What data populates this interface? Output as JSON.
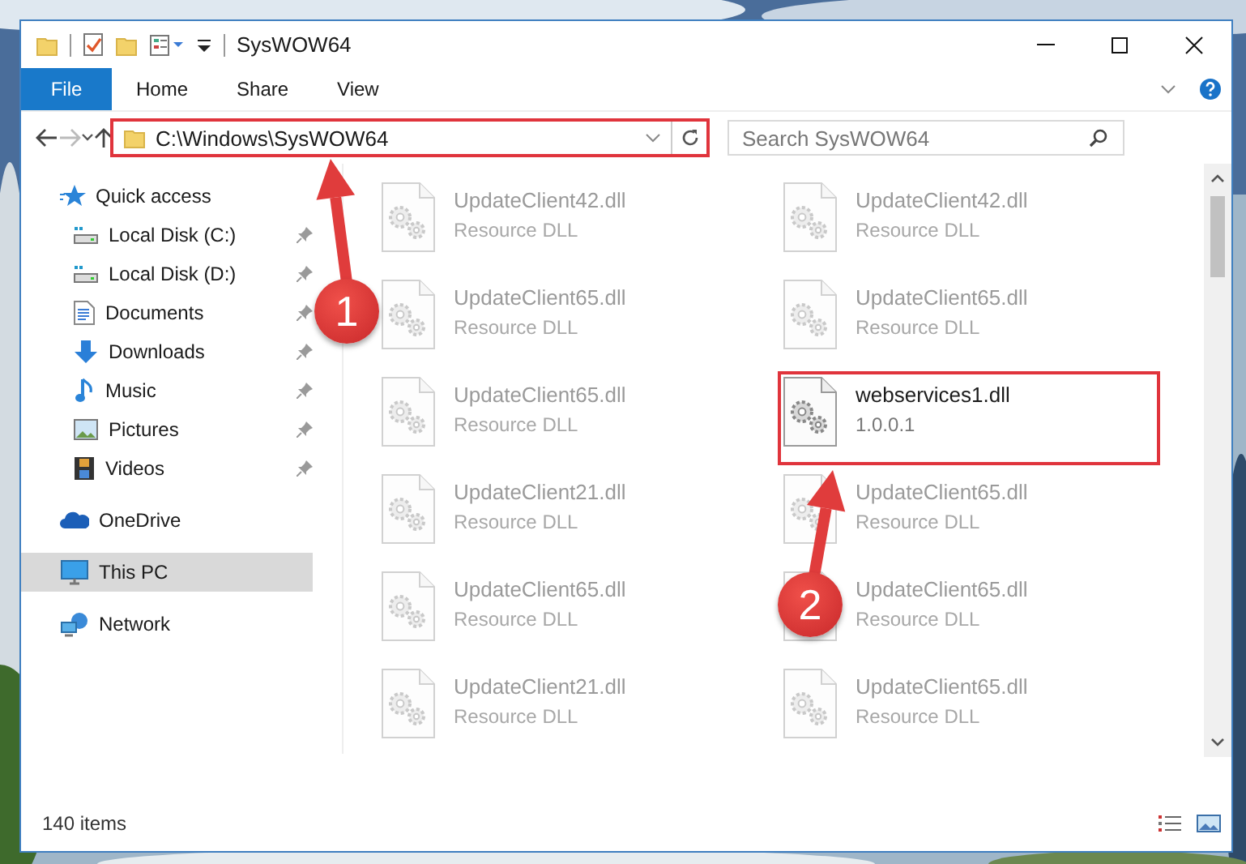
{
  "window": {
    "title": "SysWOW64"
  },
  "ribbon": {
    "tabs": [
      {
        "label": "File",
        "kind": "file"
      },
      {
        "label": "Home",
        "kind": "tab"
      },
      {
        "label": "Share",
        "kind": "tab"
      },
      {
        "label": "View",
        "kind": "tab"
      }
    ]
  },
  "address_bar": {
    "path": "C:\\Windows\\SysWOW64",
    "highlighted": true
  },
  "search": {
    "placeholder": "Search SysWOW64"
  },
  "navigation": [
    {
      "label": "Quick access",
      "kind": "star",
      "selected": false,
      "children": [
        {
          "label": "Local Disk (C:)",
          "kind": "drive",
          "selected": false,
          "pinned": true
        },
        {
          "label": "Local Disk (D:)",
          "kind": "drive",
          "selected": false,
          "pinned": true
        },
        {
          "label": "Documents",
          "kind": "documents",
          "selected": false,
          "pinned": true
        },
        {
          "label": "Downloads",
          "kind": "downloads",
          "selected": false,
          "pinned": true
        },
        {
          "label": "Music",
          "kind": "music",
          "selected": false,
          "pinned": true
        },
        {
          "label": "Pictures",
          "kind": "pictures",
          "selected": false,
          "pinned": true
        },
        {
          "label": "Videos",
          "kind": "videos",
          "selected": false,
          "pinned": true
        }
      ]
    },
    {
      "label": "OneDrive",
      "kind": "cloud",
      "selected": false
    },
    {
      "label": "This PC",
      "kind": "computer",
      "selected": true
    },
    {
      "label": "Network",
      "kind": "network",
      "selected": false
    }
  ],
  "files": [
    {
      "name": "UpdateClient42.dll",
      "detail": "Resource DLL",
      "blurred": true,
      "highlighted": false
    },
    {
      "name": "UpdateClient42.dll",
      "detail": "Resource DLL",
      "blurred": true,
      "highlighted": false
    },
    {
      "name": "UpdateClient65.dll",
      "detail": "Resource DLL",
      "blurred": true,
      "highlighted": false
    },
    {
      "name": "UpdateClient65.dll",
      "detail": "Resource DLL",
      "blurred": true,
      "highlighted": false
    },
    {
      "name": "UpdateClient65.dll",
      "detail": "Resource DLL",
      "blurred": true,
      "highlighted": false
    },
    {
      "name": "webservices1.dll",
      "detail": "1.0.0.1",
      "blurred": false,
      "highlighted": true
    },
    {
      "name": "UpdateClient21.dll",
      "detail": "Resource DLL",
      "blurred": true,
      "highlighted": false
    },
    {
      "name": "UpdateClient65.dll",
      "detail": "Resource DLL",
      "blurred": true,
      "highlighted": false
    },
    {
      "name": "UpdateClient65.dll",
      "detail": "Resource DLL",
      "blurred": true,
      "highlighted": false
    },
    {
      "name": "UpdateClient65.dll",
      "detail": "Resource DLL",
      "blurred": true,
      "highlighted": false
    },
    {
      "name": "UpdateClient21.dll",
      "detail": "Resource DLL",
      "blurred": true,
      "highlighted": false
    },
    {
      "name": "UpdateClient65.dll",
      "detail": "Resource DLL",
      "blurred": true,
      "highlighted": false
    }
  ],
  "status_bar": {
    "item_count": "140 items"
  },
  "annotations": [
    {
      "kind": "callout",
      "number": "1"
    },
    {
      "kind": "callout",
      "number": "2"
    }
  ]
}
